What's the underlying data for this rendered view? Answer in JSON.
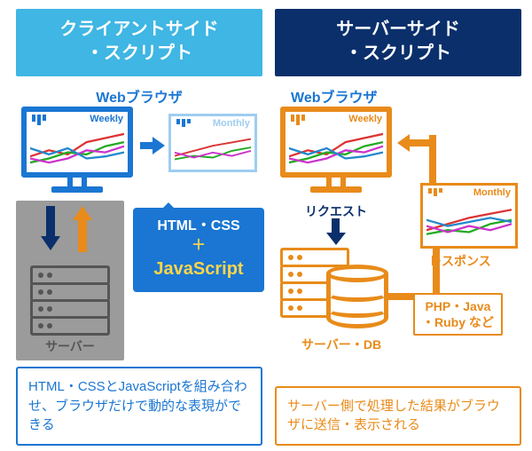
{
  "client": {
    "title_line1": "クライアントサイド",
    "title_line2": "・スクリプト",
    "browser_label": "Webブラウザ",
    "chart_weekly": "Weekly",
    "chart_monthly": "Monthly",
    "callout_line1": "HTML・CSS",
    "callout_plus": "＋",
    "callout_js": "JavaScript",
    "server_label": "サーバー",
    "description": "HTML・CSSとJavaScriptを組み合わせ、ブラウザだけで動的な表現ができる"
  },
  "server": {
    "title_line1": "サーバーサイド",
    "title_line2": "・スクリプト",
    "browser_label": "Webブラウザ",
    "chart_weekly": "Weekly",
    "chart_monthly": "Monthly",
    "request_label": "リクエスト",
    "response_label": "レスポンス",
    "server_db_label": "サーバー・DB",
    "tech_line1": "PHP・Java",
    "tech_line2": "・Ruby など",
    "description": "サーバー側で処理した結果がブラウザに送信・表示される"
  },
  "colors": {
    "cyan": "#3fb6e3",
    "navy": "#0a2f6b",
    "blue": "#1a76d2",
    "orange": "#e88b1a",
    "gray": "#9b9b9b",
    "yellow": "#ffd54a"
  }
}
